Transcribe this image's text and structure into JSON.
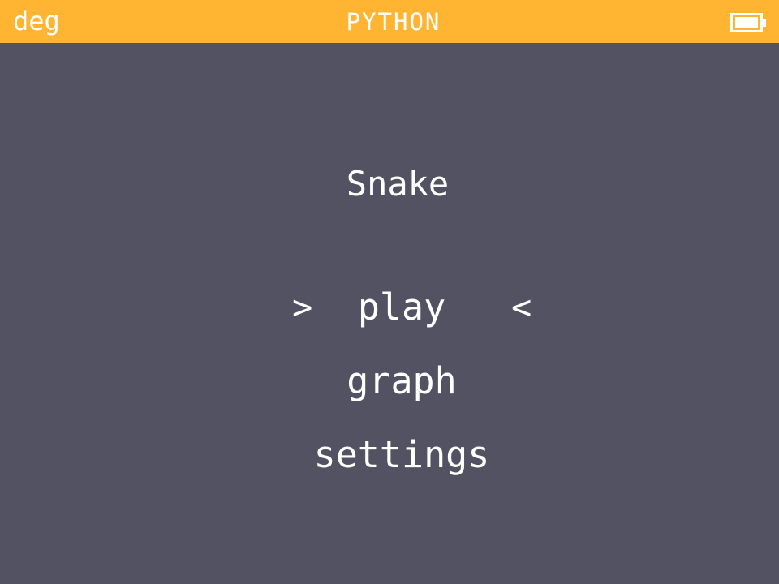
{
  "status_bar": {
    "angle_unit": "deg",
    "title": "PYTHON",
    "battery_icon": "battery-full-icon",
    "background_color": "#ffb532"
  },
  "screen": {
    "background_color": "#525262",
    "game_title": "Snake",
    "menu": {
      "items": [
        {
          "label": "play",
          "selected": true
        },
        {
          "label": "graph",
          "selected": false
        },
        {
          "label": "settings",
          "selected": false
        }
      ],
      "selector_left": ">",
      "selector_right": "<"
    }
  }
}
